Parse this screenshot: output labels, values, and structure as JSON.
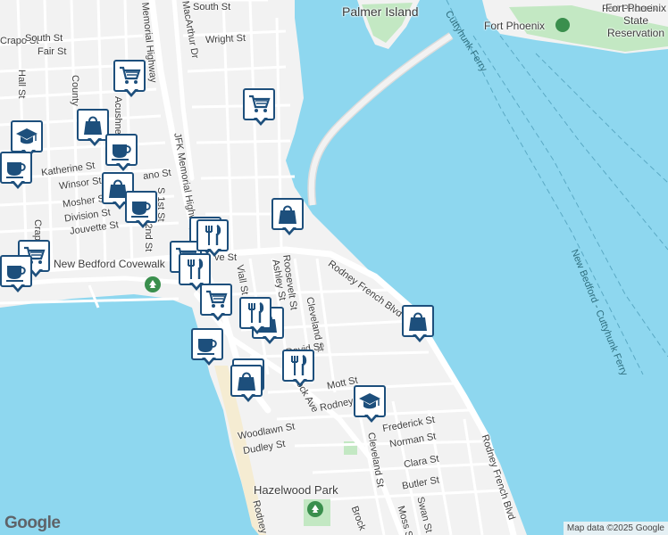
{
  "map": {
    "labels": {
      "palmer_island": "Palmer Island",
      "fort_phoenix": "Fort Phoenix",
      "fort_phoenix_state": "Fort Phoenix State Reservation",
      "ferry_top": "Cuttyhunk Ferry",
      "ferry_route": "New Bedford - Cuttyhunk Ferry",
      "covewalk": "New Bedford Covewalk",
      "hazelwood_park": "Hazelwood Park",
      "south_st": "South St",
      "wright_st": "Wright St",
      "crapo_st_top": "Crapo St",
      "south_st_2": "South St",
      "fair_st": "Fair St",
      "hall_st": "Hall St",
      "county_st": "County",
      "acushnet": "Acushnet",
      "katherine_st": "Katherine St",
      "winsor_st": "Winsor St",
      "mosher_st": "Mosher St",
      "division_st": "Division St",
      "jouvette_st": "Jouvette St",
      "crapo_st": "Crapo St",
      "s1st_st": "S 1st St",
      "s2nd_st": "S 2nd St",
      "memorial_hwy": "Memorial Highway",
      "jfk_memorial_hwy": "JFK Memorial Highway",
      "mcarthur_dr": "MacArthur Dr",
      "viall_st": "Viall St",
      "ashley_st": "Ashley St",
      "roosevelt_st": "Roosevelt St",
      "cleveland_st": "Cleveland St",
      "cleveland_st_2": "Cleveland St",
      "rodney_french_blvd": "Rodney French Blvd",
      "rodney_french_blvd_2": "Rodney French Blvd",
      "rodney_short": "Rodney",
      "rodney_bottom": "Rodney",
      "david_st": "David St",
      "mott_st": "Mott St",
      "brock_ave": "Brock Ave",
      "brock_ave_2": "Brock",
      "woodlawn_st": "Woodlawn St",
      "dudley_st": "Dudley St",
      "frederick_st": "Frederick St",
      "norman_st": "Norman St",
      "clara_st": "Clara St",
      "butler_st": "Butler St",
      "swan_st": "Swan St",
      "moss_st": "Moss St",
      "mano_st": "ano St",
      "ave_st": "ve St"
    },
    "pois": [
      {
        "type": "cart",
        "icon": "shopping-cart-icon"
      },
      {
        "type": "cart",
        "icon": "shopping-cart-icon"
      },
      {
        "type": "bag",
        "icon": "shopping-bag-icon"
      },
      {
        "type": "school",
        "icon": "graduation-cap-icon"
      },
      {
        "type": "cup",
        "icon": "coffee-cup-icon"
      },
      {
        "type": "bag",
        "icon": "shopping-bag-icon"
      },
      {
        "type": "cup",
        "icon": "coffee-cup-icon"
      },
      {
        "type": "bag",
        "icon": "shopping-bag-icon"
      },
      {
        "type": "food",
        "icon": "fork-knife-icon"
      },
      {
        "type": "cart",
        "icon": "shopping-cart-icon"
      },
      {
        "type": "food",
        "icon": "fork-knife-icon"
      },
      {
        "type": "cart",
        "icon": "shopping-cart-icon"
      },
      {
        "type": "food",
        "icon": "fork-knife-icon"
      },
      {
        "type": "bag",
        "icon": "shopping-bag-icon"
      },
      {
        "type": "cup",
        "icon": "coffee-cup-icon"
      },
      {
        "type": "food",
        "icon": "fork-knife-icon"
      },
      {
        "type": "bag",
        "icon": "shopping-bag-icon"
      },
      {
        "type": "school",
        "icon": "graduation-cap-icon"
      },
      {
        "type": "food",
        "icon": "fork-knife-icon"
      },
      {
        "type": "bag",
        "icon": "shopping-bag-icon"
      },
      {
        "type": "school",
        "icon": "graduation-cap-icon"
      },
      {
        "type": "cart",
        "icon": "shopping-cart-icon"
      },
      {
        "type": "cup",
        "icon": "coffee-cup-icon"
      },
      {
        "type": "cup",
        "icon": "coffee-cup-icon"
      }
    ],
    "google_logo": "Google",
    "attribution": "Map data ©2025 Google"
  },
  "colors": {
    "water": "#8ed7ef",
    "land": "#f2f2f2",
    "park": "#c3e8c3",
    "road": "#ffffff",
    "road_major": "#ffffff",
    "poi_border": "#1d4f7c",
    "ferry_line": "#5aa9c4"
  }
}
